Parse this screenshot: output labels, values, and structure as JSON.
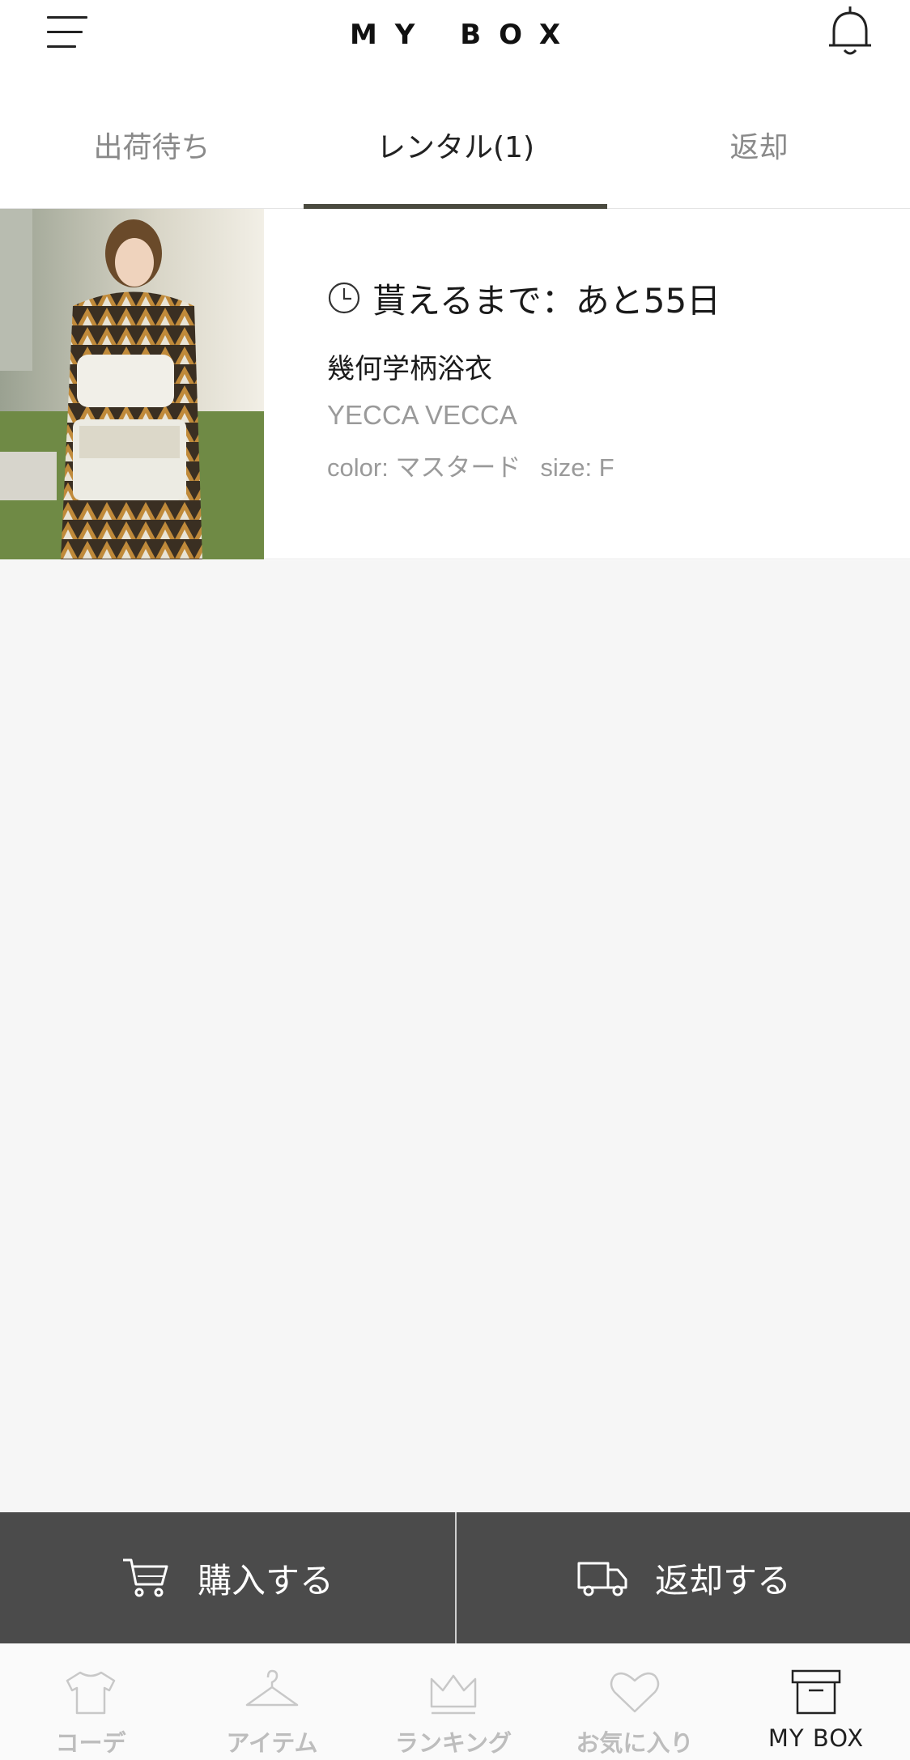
{
  "header": {
    "title": "MY BOX",
    "menu_icon": "hamburger-menu-icon",
    "bell_icon": "bell-icon"
  },
  "tabs": [
    {
      "label": "出荷待ち",
      "active": false
    },
    {
      "label": "レンタル(1)",
      "active": true
    },
    {
      "label": "返却",
      "active": false
    }
  ],
  "item": {
    "countdown": "貰えるまで：あと55日",
    "countdown_icon": "clock-icon",
    "name": "幾何学柄浴衣",
    "brand": "YECCA VECCA",
    "color": "color: マスタード",
    "size": "size: F"
  },
  "actions": {
    "purchase_label": "購入する",
    "purchase_icon": "cart-icon",
    "return_label": "返却する",
    "return_icon": "truck-icon"
  },
  "nav": [
    {
      "label": "コーデ",
      "icon": "tshirt-icon",
      "active": false
    },
    {
      "label": "アイテム",
      "icon": "hanger-icon",
      "active": false
    },
    {
      "label": "ランキング",
      "icon": "crown-icon",
      "active": false
    },
    {
      "label": "お気に入り",
      "icon": "heart-icon",
      "active": false
    },
    {
      "label": "MY BOX",
      "icon": "box-icon",
      "active": true
    }
  ],
  "colors": {
    "tab_indicator": "#4a4a3f",
    "action_bar": "#4b4b4b",
    "body_background": "#f6f6f6",
    "nav_inactive": "#bdbdbd",
    "nav_active": "#1f1f1f"
  }
}
